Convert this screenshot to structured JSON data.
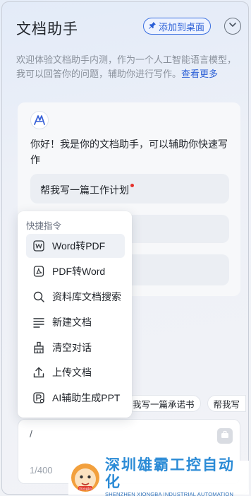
{
  "header": {
    "title": "文档助手",
    "pin_label": "添加到桌面",
    "pin_icon": "pin-icon",
    "collapse_icon": "chevron-down-icon"
  },
  "intro": {
    "text": "欢迎体验文档助手内测，作为一个人工智能语言模型，我可以回答你的问题，辅助你进行写作。",
    "link": "查看更多"
  },
  "chat": {
    "greeting": "你好！我是你的文档助手，可以辅助你快速写作",
    "suggestions": [
      "帮我写一篇工作计划",
      "",
      ""
    ]
  },
  "chips": [
    "帮我写一篇承诺书",
    "帮我写"
  ],
  "chip_first_visible": "我写一篇承诺书",
  "input": {
    "value": "/",
    "counter": "1/400",
    "send_icon": "send-icon"
  },
  "command_menu": {
    "title": "快捷指令",
    "items": [
      {
        "label": "Word转PDF",
        "icon": "word-doc-icon",
        "active": true
      },
      {
        "label": "PDF转Word",
        "icon": "pdf-icon",
        "active": false
      },
      {
        "label": "资料库文档搜索",
        "icon": "search-icon",
        "active": false
      },
      {
        "label": "新建文档",
        "icon": "lines-icon",
        "active": false
      },
      {
        "label": "清空对话",
        "icon": "broom-icon",
        "active": false
      },
      {
        "label": "上传文档",
        "icon": "upload-icon",
        "active": false
      },
      {
        "label": "AI辅助生成PPT",
        "icon": "ppt-icon",
        "active": false
      }
    ]
  },
  "watermark": {
    "cn": "深圳雄霸工控自动化",
    "en": "SHENZHEN XIONGBA INDUSTRIAL AUTOMATION",
    "badge": "Xiongba"
  },
  "colors": {
    "accent": "#2b5fd6",
    "red_dot": "#e5312b",
    "watermark_blue": "#2b8bd6"
  }
}
